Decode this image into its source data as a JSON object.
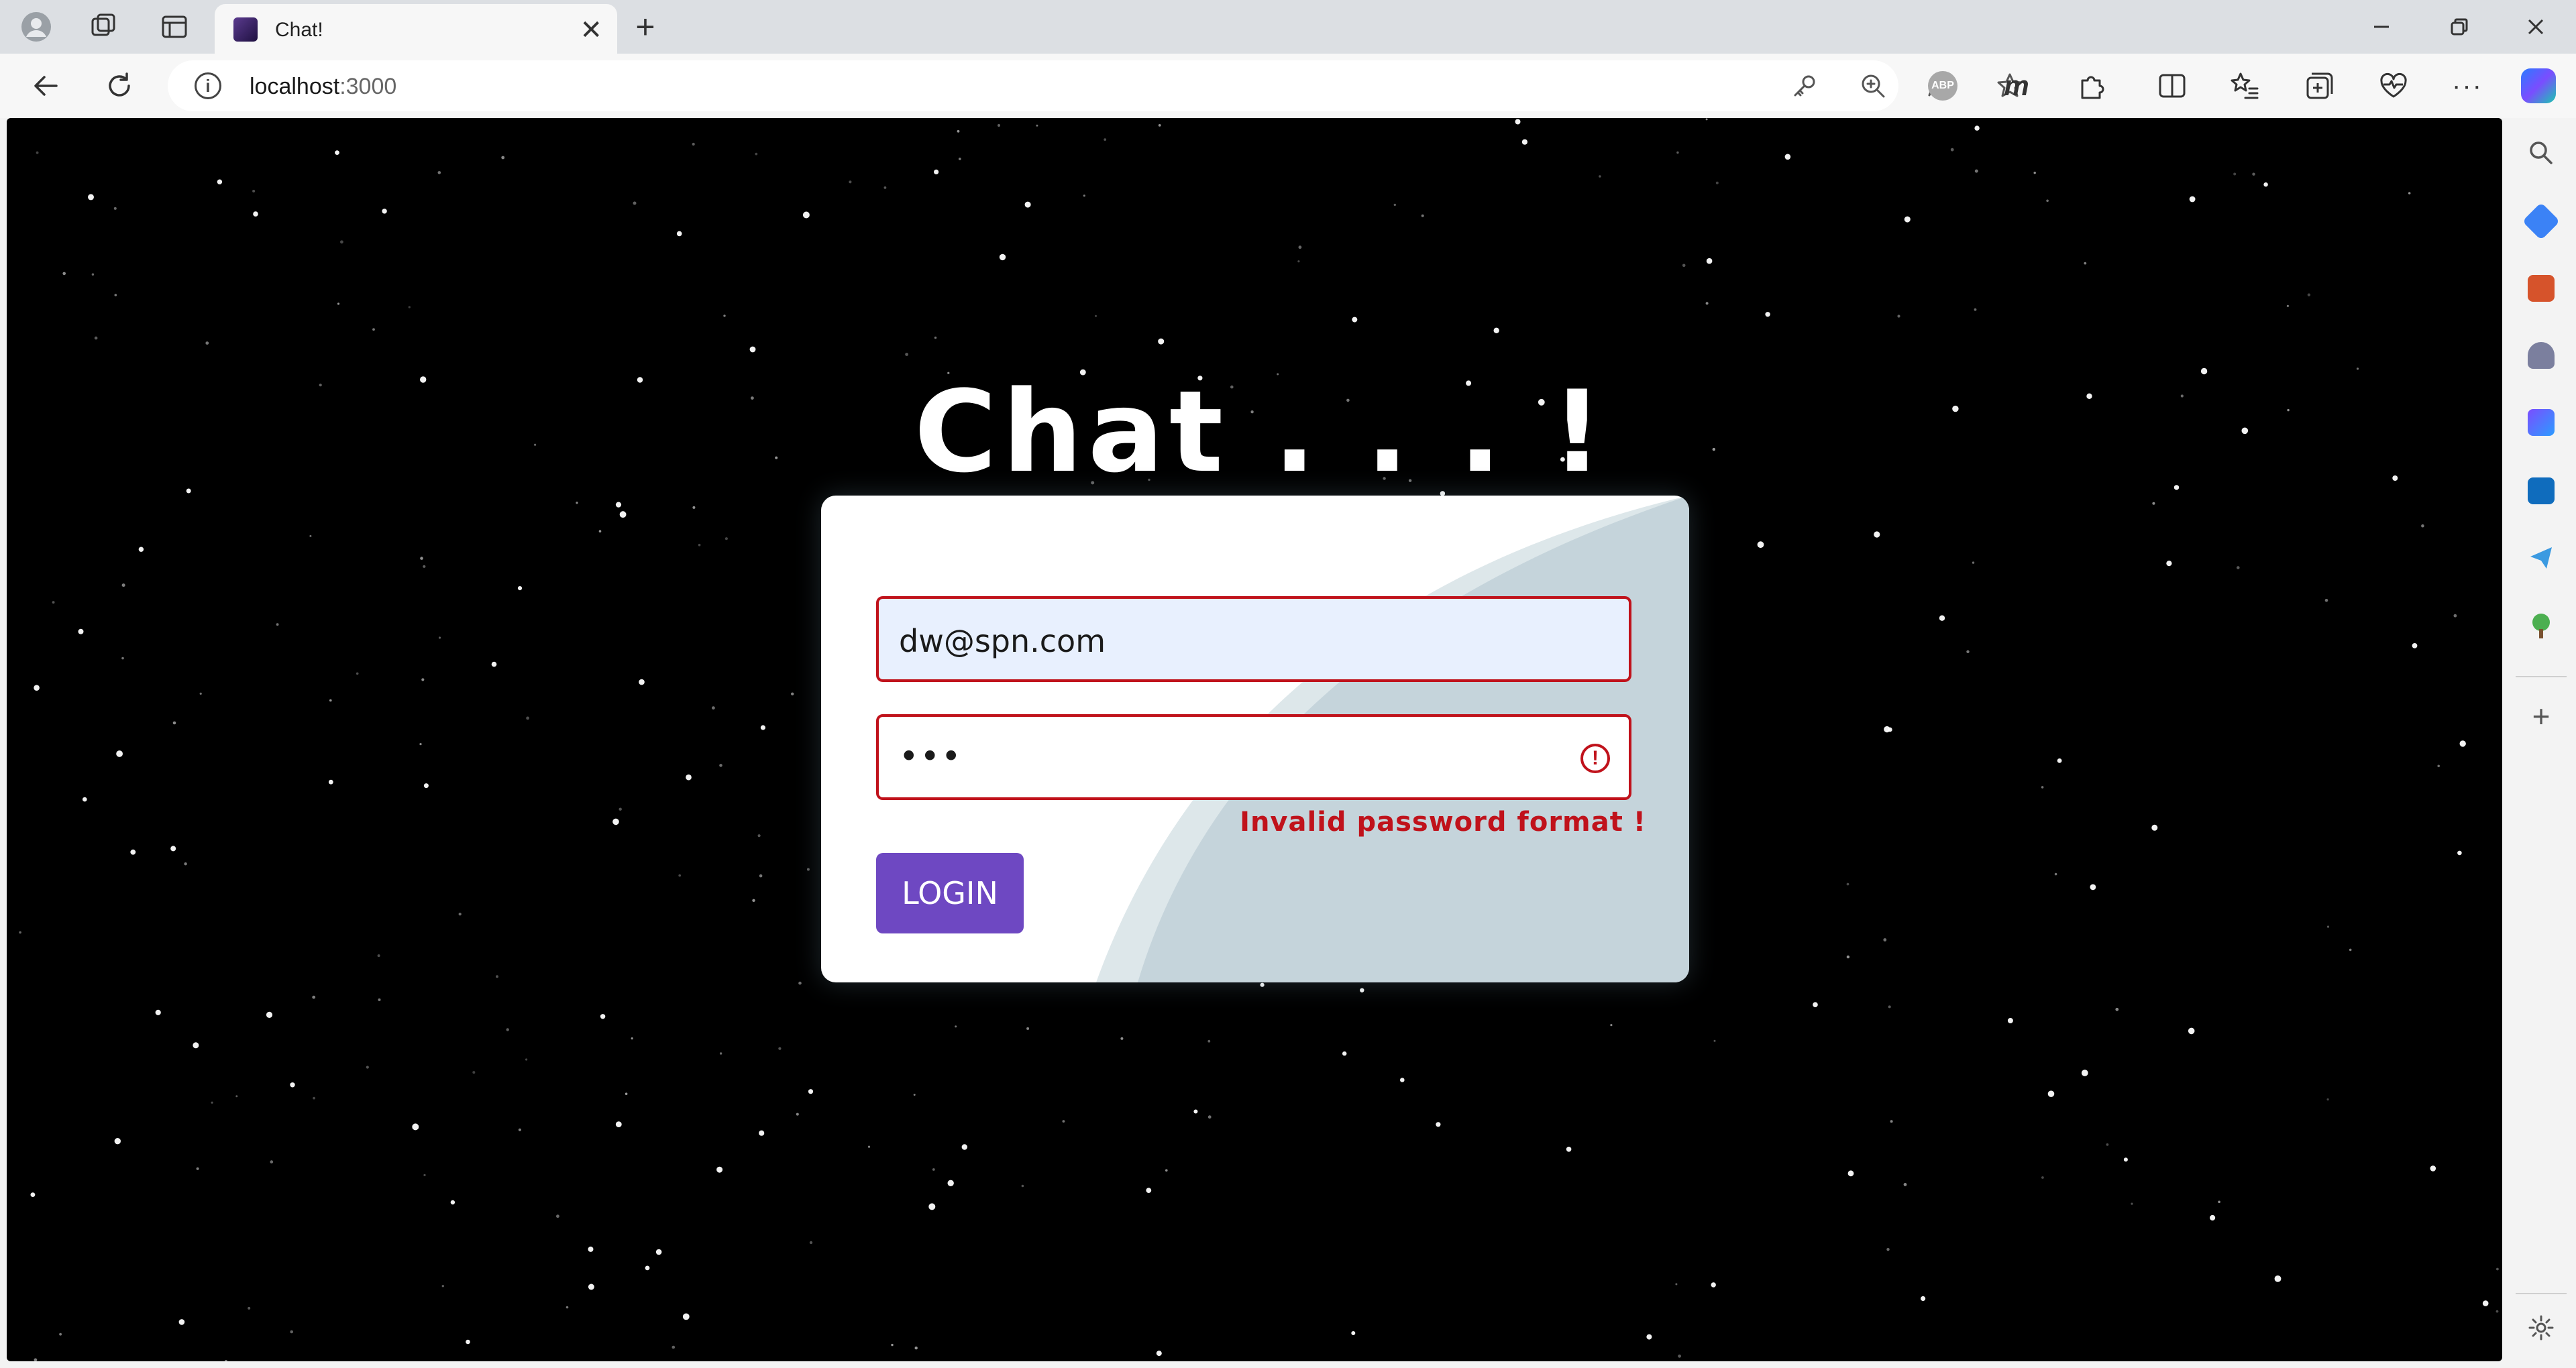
{
  "browser": {
    "tab_title": "Chat!",
    "url_host": "localhost",
    "url_port": ":3000",
    "new_tab_glyph": "+",
    "close_glyph": "✕"
  },
  "page": {
    "title": "Chat . . . !",
    "email_value": "dw@spn.com",
    "password_mask": "•••",
    "error_icon_glyph": "!",
    "error_message": "Invalid password format !",
    "login_label": "LOGIN"
  },
  "icons": {
    "profile": "profile-icon",
    "workspaces": "workspaces-icon",
    "tab-actions": "tab-actions-icon",
    "back": "back-icon",
    "refresh": "refresh-icon",
    "info": "info-icon",
    "key": "key-icon",
    "zoom": "zoom-icon",
    "read-aloud": "read-aloud-icon",
    "favorite": "favorite-star-icon",
    "adblock": "adblock-icon",
    "extensions": "extensions-icon",
    "split-screen": "split-screen-icon",
    "favorites-list": "favorites-list-icon",
    "collections": "collections-icon",
    "browser-essentials": "browser-essentials-icon",
    "more": "more-icon",
    "copilot": "copilot-icon"
  },
  "colors": {
    "error_red": "#c0121b",
    "button_purple": "#6e48c2",
    "autofill_blue": "#e8f0fe",
    "wave_light": "#dde7ea",
    "wave_dark": "#c5d4db"
  }
}
